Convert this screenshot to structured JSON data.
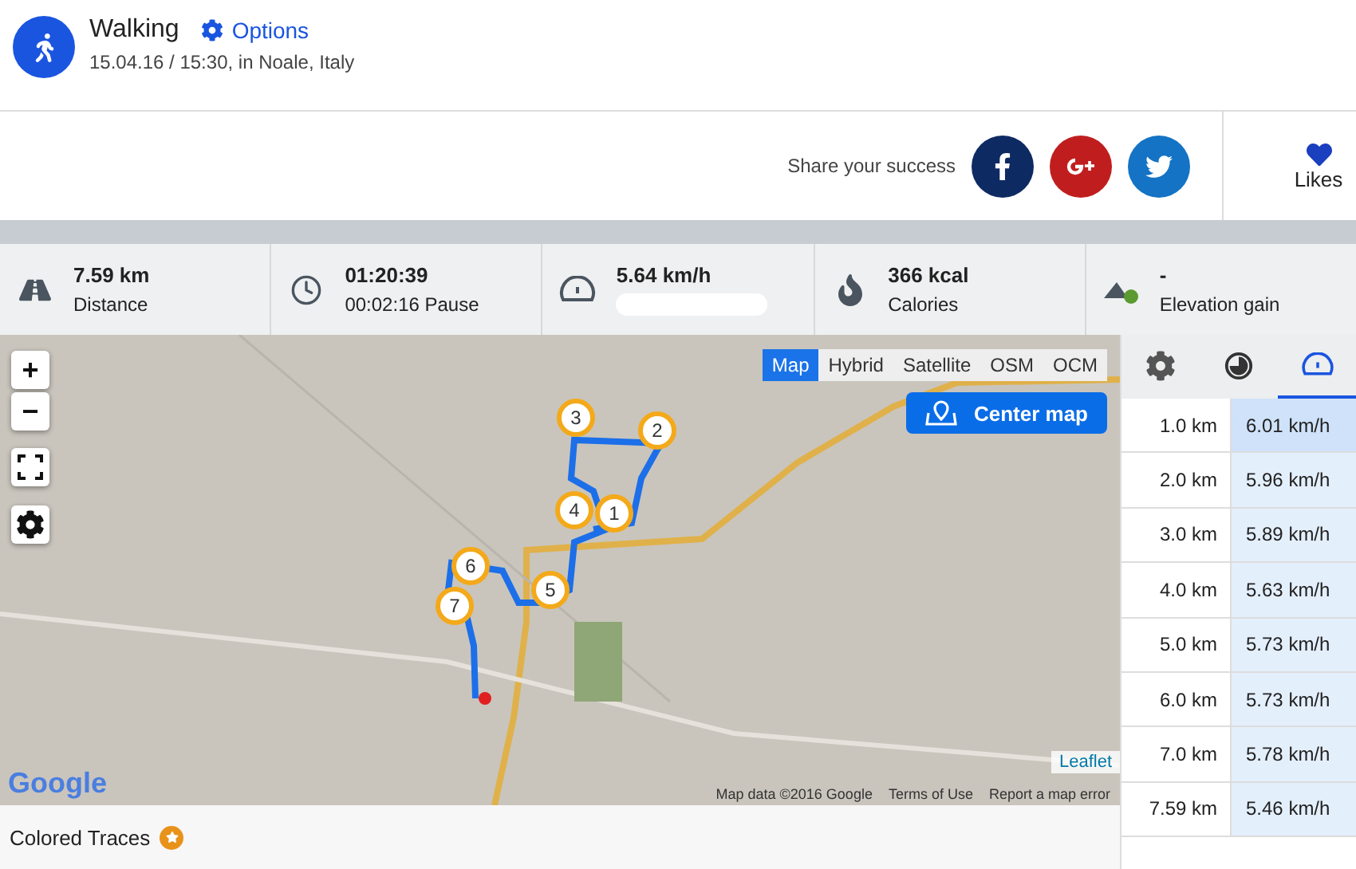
{
  "activity": {
    "title": "Walking",
    "options": "Options",
    "subtitle": "15.04.16 / 15:30, in Noale, Italy"
  },
  "share": {
    "label": "Share your success",
    "likes": "Likes"
  },
  "stats": [
    {
      "kind": "distance",
      "value": "7.59 km",
      "label": "Distance"
    },
    {
      "kind": "duration",
      "value": "01:20:39",
      "label": "00:02:16 Pause"
    },
    {
      "kind": "speed",
      "value": "5.64 km/h"
    },
    {
      "kind": "calories",
      "value": "366 kcal",
      "label": "Calories"
    },
    {
      "kind": "elevation",
      "value": "-",
      "label": "Elevation gain"
    }
  ],
  "map": {
    "layers": [
      {
        "label": "Map",
        "selected": true
      },
      {
        "label": "Hybrid",
        "selected": false
      },
      {
        "label": "Satellite",
        "selected": false
      },
      {
        "label": "OSM",
        "selected": false
      },
      {
        "label": "OCM",
        "selected": false
      }
    ],
    "center_button": "Center map",
    "zoom_in": "+",
    "zoom_out": "−",
    "markers": [
      "1",
      "2",
      "3",
      "4",
      "5",
      "6",
      "7"
    ],
    "logo": "Google",
    "leaflet": "Leaflet",
    "attribution": [
      "Map data ©2016 Google",
      "Terms of Use",
      "Report a map error"
    ]
  },
  "splits": {
    "tabs": [
      {
        "kind": "settings",
        "selected": false
      },
      {
        "kind": "time",
        "selected": false
      },
      {
        "kind": "speed",
        "selected": true
      }
    ],
    "rows": [
      {
        "distance": "1.0 km",
        "speed": "6.01 km/h",
        "selected": true
      },
      {
        "distance": "2.0 km",
        "speed": "5.96 km/h",
        "selected": false
      },
      {
        "distance": "3.0 km",
        "speed": "5.89 km/h",
        "selected": false
      },
      {
        "distance": "4.0 km",
        "speed": "5.63 km/h",
        "selected": false
      },
      {
        "distance": "5.0 km",
        "speed": "5.73 km/h",
        "selected": false
      },
      {
        "distance": "6.0 km",
        "speed": "5.73 km/h",
        "selected": false
      },
      {
        "distance": "7.0 km",
        "speed": "5.78 km/h",
        "selected": false
      },
      {
        "distance": "7.59 km",
        "speed": "5.46 km/h",
        "selected": false
      }
    ]
  },
  "footer": {
    "label": "Colored Traces"
  }
}
